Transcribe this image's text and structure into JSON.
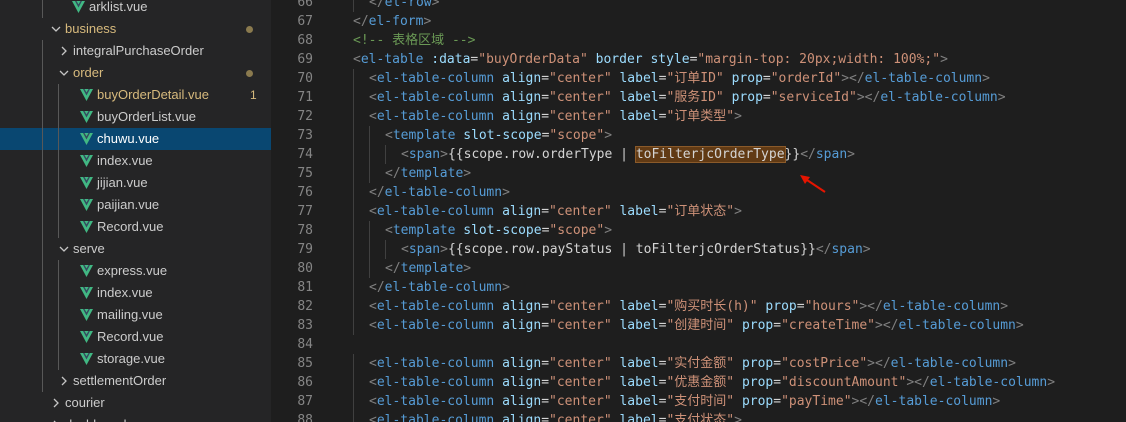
{
  "sidebar": {
    "items": [
      {
        "label": "arklist.vue",
        "indent": 1,
        "kind": "vue"
      },
      {
        "label": "business",
        "indent": 0,
        "kind": "folder-open",
        "modified": true
      },
      {
        "label": "integralPurchaseOrder",
        "indent": 1,
        "kind": "folder-closed"
      },
      {
        "label": "order",
        "indent": 1,
        "kind": "folder-open",
        "modified": true
      },
      {
        "label": "buyOrderDetail.vue",
        "indent": 2,
        "kind": "vue",
        "modified": true,
        "badge": "1"
      },
      {
        "label": "buyOrderList.vue",
        "indent": 2,
        "kind": "vue"
      },
      {
        "label": "chuwu.vue",
        "indent": 2,
        "kind": "vue",
        "selected": true
      },
      {
        "label": "index.vue",
        "indent": 2,
        "kind": "vue"
      },
      {
        "label": "jijian.vue",
        "indent": 2,
        "kind": "vue"
      },
      {
        "label": "paijian.vue",
        "indent": 2,
        "kind": "vue"
      },
      {
        "label": "Record.vue",
        "indent": 2,
        "kind": "vue"
      },
      {
        "label": "serve",
        "indent": 1,
        "kind": "folder-open"
      },
      {
        "label": "express.vue",
        "indent": 2,
        "kind": "vue"
      },
      {
        "label": "index.vue",
        "indent": 2,
        "kind": "vue"
      },
      {
        "label": "mailing.vue",
        "indent": 2,
        "kind": "vue"
      },
      {
        "label": "Record.vue",
        "indent": 2,
        "kind": "vue"
      },
      {
        "label": "storage.vue",
        "indent": 2,
        "kind": "vue"
      },
      {
        "label": "settlementOrder",
        "indent": 1,
        "kind": "folder-closed"
      },
      {
        "label": "courier",
        "indent": 0,
        "kind": "folder-closed"
      },
      {
        "label": "dashboard",
        "indent": 0,
        "kind": "folder-closed"
      }
    ]
  },
  "editor": {
    "lines": [
      {
        "n": "66",
        "indent": 1,
        "tokens": [
          [
            "p",
            "</"
          ],
          [
            "t",
            "el-row"
          ],
          [
            "p",
            ">"
          ]
        ]
      },
      {
        "n": "67",
        "indent": 0,
        "tokens": [
          [
            "p",
            "</"
          ],
          [
            "t",
            "el-form"
          ],
          [
            "p",
            ">"
          ]
        ]
      },
      {
        "n": "68",
        "indent": 0,
        "tokens": [
          [
            "c",
            "<!-- 表格区域 -->"
          ]
        ]
      },
      {
        "n": "69",
        "indent": 0,
        "tokens": [
          [
            "p",
            "<"
          ],
          [
            "t",
            "el-table"
          ],
          [
            "x",
            " "
          ],
          [
            "a",
            ":data"
          ],
          [
            "x",
            "="
          ],
          [
            "s",
            "\"buyOrderData\""
          ],
          [
            "x",
            " "
          ],
          [
            "a",
            "border"
          ],
          [
            "x",
            " "
          ],
          [
            "a",
            "style"
          ],
          [
            "x",
            "="
          ],
          [
            "s",
            "\"margin-top: 20px;width: 100%;\""
          ],
          [
            "p",
            ">"
          ]
        ]
      },
      {
        "n": "70",
        "indent": 1,
        "tokens": [
          [
            "p",
            "<"
          ],
          [
            "t",
            "el-table-column"
          ],
          [
            "x",
            " "
          ],
          [
            "a",
            "align"
          ],
          [
            "x",
            "="
          ],
          [
            "s",
            "\"center\""
          ],
          [
            "x",
            " "
          ],
          [
            "a",
            "label"
          ],
          [
            "x",
            "="
          ],
          [
            "s",
            "\"订单ID\""
          ],
          [
            "x",
            " "
          ],
          [
            "a",
            "prop"
          ],
          [
            "x",
            "="
          ],
          [
            "s",
            "\"orderId\""
          ],
          [
            "p",
            "></"
          ],
          [
            "t",
            "el-table-column"
          ],
          [
            "p",
            ">"
          ]
        ]
      },
      {
        "n": "71",
        "indent": 1,
        "tokens": [
          [
            "p",
            "<"
          ],
          [
            "t",
            "el-table-column"
          ],
          [
            "x",
            " "
          ],
          [
            "a",
            "align"
          ],
          [
            "x",
            "="
          ],
          [
            "s",
            "\"center\""
          ],
          [
            "x",
            " "
          ],
          [
            "a",
            "label"
          ],
          [
            "x",
            "="
          ],
          [
            "s",
            "\"服务ID\""
          ],
          [
            "x",
            " "
          ],
          [
            "a",
            "prop"
          ],
          [
            "x",
            "="
          ],
          [
            "s",
            "\"serviceId\""
          ],
          [
            "p",
            "></"
          ],
          [
            "t",
            "el-table-column"
          ],
          [
            "p",
            ">"
          ]
        ]
      },
      {
        "n": "72",
        "indent": 1,
        "tokens": [
          [
            "p",
            "<"
          ],
          [
            "t",
            "el-table-column"
          ],
          [
            "x",
            " "
          ],
          [
            "a",
            "align"
          ],
          [
            "x",
            "="
          ],
          [
            "s",
            "\"center\""
          ],
          [
            "x",
            " "
          ],
          [
            "a",
            "label"
          ],
          [
            "x",
            "="
          ],
          [
            "s",
            "\"订单类型\""
          ],
          [
            "p",
            ">"
          ]
        ]
      },
      {
        "n": "73",
        "indent": 2,
        "tokens": [
          [
            "p",
            "<"
          ],
          [
            "t",
            "template"
          ],
          [
            "x",
            " "
          ],
          [
            "a",
            "slot-scope"
          ],
          [
            "x",
            "="
          ],
          [
            "s",
            "\"scope\""
          ],
          [
            "p",
            ">"
          ]
        ]
      },
      {
        "n": "74",
        "indent": 3,
        "tokens": [
          [
            "p",
            "<"
          ],
          [
            "t",
            "span"
          ],
          [
            "p",
            ">"
          ],
          [
            "x",
            "{{scope.row.orderType | "
          ],
          [
            "hl",
            "toFilterjcOrderType"
          ],
          [
            "x",
            "}}"
          ],
          [
            "p",
            "</"
          ],
          [
            "t",
            "span"
          ],
          [
            "p",
            ">"
          ]
        ]
      },
      {
        "n": "75",
        "indent": 2,
        "tokens": [
          [
            "p",
            "</"
          ],
          [
            "t",
            "template"
          ],
          [
            "p",
            ">"
          ]
        ]
      },
      {
        "n": "76",
        "indent": 1,
        "tokens": [
          [
            "p",
            "</"
          ],
          [
            "t",
            "el-table-column"
          ],
          [
            "p",
            ">"
          ]
        ]
      },
      {
        "n": "77",
        "indent": 1,
        "tokens": [
          [
            "p",
            "<"
          ],
          [
            "t",
            "el-table-column"
          ],
          [
            "x",
            " "
          ],
          [
            "a",
            "align"
          ],
          [
            "x",
            "="
          ],
          [
            "s",
            "\"center\""
          ],
          [
            "x",
            " "
          ],
          [
            "a",
            "label"
          ],
          [
            "x",
            "="
          ],
          [
            "s",
            "\"订单状态\""
          ],
          [
            "p",
            ">"
          ]
        ]
      },
      {
        "n": "78",
        "indent": 2,
        "tokens": [
          [
            "p",
            "<"
          ],
          [
            "t",
            "template"
          ],
          [
            "x",
            " "
          ],
          [
            "a",
            "slot-scope"
          ],
          [
            "x",
            "="
          ],
          [
            "s",
            "\"scope\""
          ],
          [
            "p",
            ">"
          ]
        ]
      },
      {
        "n": "79",
        "indent": 3,
        "tokens": [
          [
            "p",
            "<"
          ],
          [
            "t",
            "span"
          ],
          [
            "p",
            ">"
          ],
          [
            "x",
            "{{scope.row.payStatus | toFilterjcOrderStatus}}"
          ],
          [
            "p",
            "</"
          ],
          [
            "t",
            "span"
          ],
          [
            "p",
            ">"
          ]
        ]
      },
      {
        "n": "80",
        "indent": 2,
        "tokens": [
          [
            "p",
            "</"
          ],
          [
            "t",
            "template"
          ],
          [
            "p",
            ">"
          ]
        ]
      },
      {
        "n": "81",
        "indent": 1,
        "tokens": [
          [
            "p",
            "</"
          ],
          [
            "t",
            "el-table-column"
          ],
          [
            "p",
            ">"
          ]
        ]
      },
      {
        "n": "82",
        "indent": 1,
        "tokens": [
          [
            "p",
            "<"
          ],
          [
            "t",
            "el-table-column"
          ],
          [
            "x",
            " "
          ],
          [
            "a",
            "align"
          ],
          [
            "x",
            "="
          ],
          [
            "s",
            "\"center\""
          ],
          [
            "x",
            " "
          ],
          [
            "a",
            "label"
          ],
          [
            "x",
            "="
          ],
          [
            "s",
            "\"购买时长(h)\""
          ],
          [
            "x",
            " "
          ],
          [
            "a",
            "prop"
          ],
          [
            "x",
            "="
          ],
          [
            "s",
            "\"hours\""
          ],
          [
            "p",
            "></"
          ],
          [
            "t",
            "el-table-column"
          ],
          [
            "p",
            ">"
          ]
        ]
      },
      {
        "n": "83",
        "indent": 1,
        "tokens": [
          [
            "p",
            "<"
          ],
          [
            "t",
            "el-table-column"
          ],
          [
            "x",
            " "
          ],
          [
            "a",
            "align"
          ],
          [
            "x",
            "="
          ],
          [
            "s",
            "\"center\""
          ],
          [
            "x",
            " "
          ],
          [
            "a",
            "label"
          ],
          [
            "x",
            "="
          ],
          [
            "s",
            "\"创建时间\""
          ],
          [
            "x",
            " "
          ],
          [
            "a",
            "prop"
          ],
          [
            "x",
            "="
          ],
          [
            "s",
            "\"createTime\""
          ],
          [
            "p",
            "></"
          ],
          [
            "t",
            "el-table-column"
          ],
          [
            "p",
            ">"
          ]
        ]
      },
      {
        "n": "84",
        "indent": 0,
        "tokens": []
      },
      {
        "n": "85",
        "indent": 1,
        "tokens": [
          [
            "p",
            "<"
          ],
          [
            "t",
            "el-table-column"
          ],
          [
            "x",
            " "
          ],
          [
            "a",
            "align"
          ],
          [
            "x",
            "="
          ],
          [
            "s",
            "\"center\""
          ],
          [
            "x",
            " "
          ],
          [
            "a",
            "label"
          ],
          [
            "x",
            "="
          ],
          [
            "s",
            "\"实付金额\""
          ],
          [
            "x",
            " "
          ],
          [
            "a",
            "prop"
          ],
          [
            "x",
            "="
          ],
          [
            "s",
            "\"costPrice\""
          ],
          [
            "p",
            "></"
          ],
          [
            "t",
            "el-table-column"
          ],
          [
            "p",
            ">"
          ]
        ]
      },
      {
        "n": "86",
        "indent": 1,
        "tokens": [
          [
            "p",
            "<"
          ],
          [
            "t",
            "el-table-column"
          ],
          [
            "x",
            " "
          ],
          [
            "a",
            "align"
          ],
          [
            "x",
            "="
          ],
          [
            "s",
            "\"center\""
          ],
          [
            "x",
            " "
          ],
          [
            "a",
            "label"
          ],
          [
            "x",
            "="
          ],
          [
            "s",
            "\"优惠金额\""
          ],
          [
            "x",
            " "
          ],
          [
            "a",
            "prop"
          ],
          [
            "x",
            "="
          ],
          [
            "s",
            "\"discountAmount\""
          ],
          [
            "p",
            "></"
          ],
          [
            "t",
            "el-table-column"
          ],
          [
            "p",
            ">"
          ]
        ]
      },
      {
        "n": "87",
        "indent": 1,
        "tokens": [
          [
            "p",
            "<"
          ],
          [
            "t",
            "el-table-column"
          ],
          [
            "x",
            " "
          ],
          [
            "a",
            "align"
          ],
          [
            "x",
            "="
          ],
          [
            "s",
            "\"center\""
          ],
          [
            "x",
            " "
          ],
          [
            "a",
            "label"
          ],
          [
            "x",
            "="
          ],
          [
            "s",
            "\"支付时间\""
          ],
          [
            "x",
            " "
          ],
          [
            "a",
            "prop"
          ],
          [
            "x",
            "="
          ],
          [
            "s",
            "\"payTime\""
          ],
          [
            "p",
            "></"
          ],
          [
            "t",
            "el-table-column"
          ],
          [
            "p",
            ">"
          ]
        ]
      },
      {
        "n": "88",
        "indent": 1,
        "tokens": [
          [
            "p",
            "<"
          ],
          [
            "t",
            "el-table-column"
          ],
          [
            "x",
            " "
          ],
          [
            "a",
            "align"
          ],
          [
            "x",
            "="
          ],
          [
            "s",
            "\"center\""
          ],
          [
            "x",
            " "
          ],
          [
            "a",
            "label"
          ],
          [
            "x",
            "="
          ],
          [
            "s",
            "\"支付状态\""
          ],
          [
            "p",
            ">"
          ]
        ]
      }
    ]
  },
  "colors": {
    "accent_selected": "#094771",
    "modified": "#d7ba7d",
    "arrow": "#e51400",
    "vue_icon": "#41b883"
  }
}
